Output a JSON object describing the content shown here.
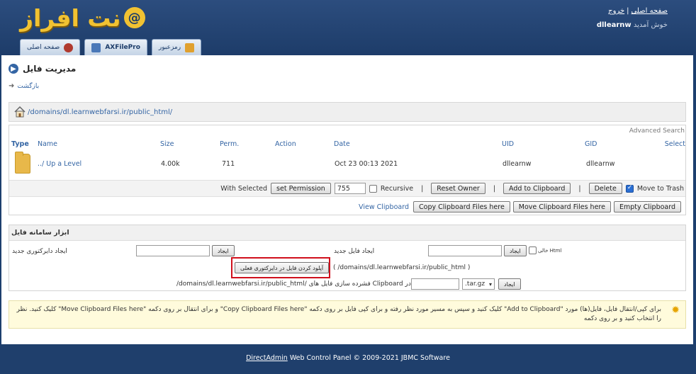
{
  "header": {
    "logo_text": "نت افراز",
    "links": {
      "home": "صفحه اصلی",
      "logout": "خروج",
      "separator": "|"
    },
    "welcome_user": "dllearnw",
    "welcome_text": "خوش آمدید"
  },
  "tabs": [
    {
      "label": "صفحه اصلی",
      "icon": "home-tab-icon"
    },
    {
      "label": "AXFilePro",
      "icon": "axfilepro-icon"
    },
    {
      "label": "رمزعبور",
      "icon": "password-icon"
    }
  ],
  "page": {
    "title": "مدیریت فایل",
    "back": "بازگشت"
  },
  "path": {
    "display": "/domains/dl.learnwebfarsi.ir/public_html/"
  },
  "files": {
    "advanced_search": "Advanced Search",
    "columns": [
      "Type",
      "Name",
      "Size",
      "Perm.",
      "Action",
      "Date",
      "UID",
      "GID",
      "Select"
    ],
    "rows": [
      {
        "name": "../ Up a Level",
        "size": "4.00k",
        "perm": "711",
        "date": "Oct 23 00:13 2021",
        "uid": "dllearnw",
        "gid": "dllearnw"
      }
    ],
    "selection": {
      "with_selected": "With Selected",
      "set_permission": "set Permission",
      "perm_value": "755",
      "recursive": "Recursive",
      "reset_owner": "Reset Owner",
      "add_clipboard": "Add to Clipboard",
      "delete": "Delete",
      "move_to_trash": "Move to Trash",
      "sep": "|"
    },
    "clipboard": {
      "view": "View Clipboard",
      "copy": "Copy Clipboard Files here",
      "move": "Move Clipboard Files here",
      "empty": "Empty Clipboard"
    }
  },
  "tools": {
    "title": "ابزار سامانه فایل",
    "new_dir_label": "ایجاد دایرکتوری جدید",
    "create": "ایجاد",
    "new_file_label": "ایجاد فایل جدید",
    "html_label": "خالی Html",
    "upload_button": "آپلود کردن فایل در دایرکتوری فعلی",
    "upload_path": "( /domains/dl.learnwebfarsi.ir/public_html )",
    "archive_label": "/domains/dl.learnwebfarsi.ir/public_html/ فشرده سازی فایل های Clipboard در",
    "archive_ext": ".tar.gz"
  },
  "notice": {
    "text": "برای کپی/انتقال فایل، فایل(ها) مورد \"Add to Clipboard\" کلیک کنید و سپس به مسیر مورد نظر رفته و برای کپی فایل بر روی دکمه \"Copy Clipboard Files here\" و برای انتقال بر روی دکمه \"Move Clipboard Files here\" کلیک کنید. نظر را انتخاب کنید و بر روی دکمه"
  },
  "footer": {
    "brand": "DirectAdmin",
    "text": " Web Control Panel © 2009-2021 JBMC Software"
  },
  "colors": {
    "header": "#1d3c69",
    "link": "#3465a4",
    "highlight": "#d0101c",
    "logo": "#f1c232"
  }
}
